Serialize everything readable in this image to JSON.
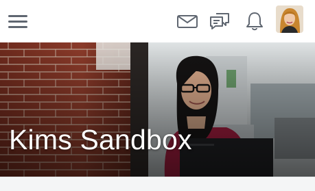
{
  "header": {
    "menu_icon": "hamburger-menu-icon",
    "icons": [
      "envelope-icon",
      "chat-bubbles-icon",
      "bell-icon"
    ],
    "avatar": "user-avatar"
  },
  "banner": {
    "title": "Kims Sandbox"
  },
  "colors": {
    "icon_gray": "#5f6670",
    "banner_text": "#ffffff",
    "brick": "#8c3b2a",
    "jacket": "#9b1c3c"
  }
}
